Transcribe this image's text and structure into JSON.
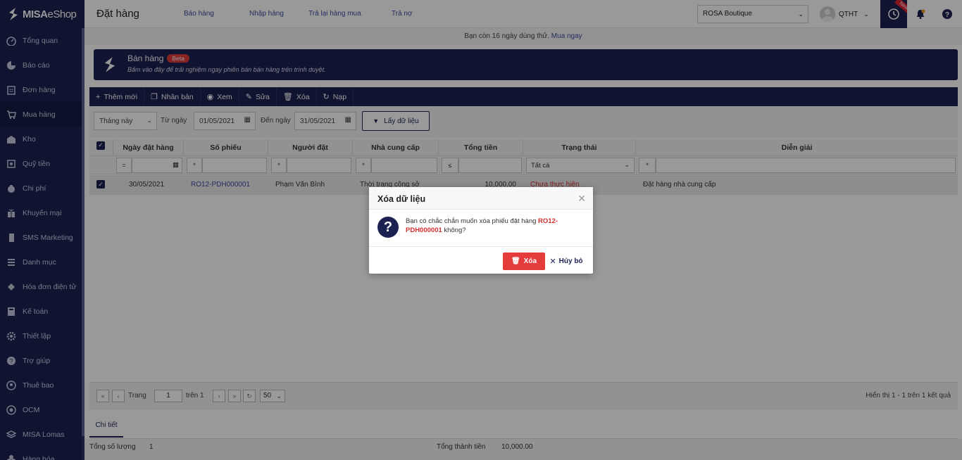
{
  "brand": {
    "name_bold": "MISA",
    "name_light": "eShop"
  },
  "sidebar": {
    "items": [
      {
        "label": "Tổng quan",
        "icon": "dashboard-icon"
      },
      {
        "label": "Báo cáo",
        "icon": "pie-chart-icon"
      },
      {
        "label": "Đơn hàng",
        "icon": "order-icon"
      },
      {
        "label": "Mua hàng",
        "icon": "cart-icon"
      },
      {
        "label": "Kho",
        "icon": "warehouse-icon"
      },
      {
        "label": "Quỹ tiền",
        "icon": "safe-icon"
      },
      {
        "label": "Chi phí",
        "icon": "money-bag-icon"
      },
      {
        "label": "Khuyến mại",
        "icon": "gift-icon"
      },
      {
        "label": "SMS Marketing",
        "icon": "phone-icon"
      },
      {
        "label": "Danh mục",
        "icon": "list-icon"
      },
      {
        "label": "Hóa đơn điện tử",
        "icon": "invoice-icon"
      },
      {
        "label": "Kế toán",
        "icon": "calculator-icon"
      },
      {
        "label": "Thiết lập",
        "icon": "gear-icon"
      },
      {
        "label": "Trợ giúp",
        "icon": "help-icon"
      },
      {
        "label": "Thuê bao",
        "icon": "user-icon"
      },
      {
        "label": "OCM",
        "icon": "ocm-icon"
      },
      {
        "label": "MISA Lomas",
        "icon": "lomas-icon"
      },
      {
        "label": "Hàng hóa",
        "icon": "goods-icon"
      }
    ]
  },
  "header": {
    "title": "Đặt hàng",
    "links": [
      "Báo hàng",
      "Nhập hàng",
      "Trả lại hàng mua",
      "Trả nợ"
    ],
    "shop": "ROSA Boutique",
    "user": "QTHT",
    "new_badge": "New"
  },
  "trial": {
    "text": "Bạn còn 16 ngày dùng thử.",
    "link": "Mua ngay"
  },
  "banner": {
    "title": "Bán hàng",
    "badge": "Beta",
    "subtitle": "Bấm vào đây để trải nghiệm ngay phiên bán bán hàng trên trình duyệt."
  },
  "toolbar": {
    "add": "Thêm mới",
    "copy": "Nhân bản",
    "view": "Xem",
    "edit": "Sửa",
    "delete": "Xóa",
    "reload": "Nạp"
  },
  "filters": {
    "period": "Tháng này",
    "from_label": "Từ ngày",
    "from": "01/05/2021",
    "to_label": "Đến ngày",
    "to": "31/05/2021",
    "get_button": "Lấy dữ liệu"
  },
  "grid": {
    "columns": [
      "Ngày đặt hàng",
      "Số phiếu",
      "Người đặt",
      "Nhà cung cấp",
      "Tổng tiền",
      "Trạng thái",
      "Diễn giải"
    ],
    "filter_ops": {
      "date": "=",
      "number": "*",
      "person": "*",
      "supplier": "*",
      "total": "≤",
      "desc": "*"
    },
    "status_filter": "Tất cả",
    "rows": [
      {
        "date": "30/05/2021",
        "number": "RO12-PDH000001",
        "person": "Phạm Văn Bình",
        "supplier": "Thời trang công sở",
        "total": "10,000.00",
        "status": "Chưa thực hiện",
        "desc": "Đặt hàng nhà cung cấp"
      }
    ]
  },
  "pager": {
    "page_label": "Trang",
    "page": "1",
    "of_label": "trên 1",
    "page_size": "50",
    "summary": "Hiển thị 1 - 1 trên 1 kết quả"
  },
  "detail": {
    "tab": "Chi tiết"
  },
  "summary": {
    "qty_label": "Tổng số lượng",
    "qty": "1",
    "total_label": "Tổng thành tiền",
    "total": "10,000.00"
  },
  "dialog": {
    "title": "Xóa dữ liệu",
    "message_before": "Bạn có chắc chắn muốn xóa phiếu đặt hàng",
    "doc_number": "RO12-PDH000001",
    "message_after": "không?",
    "delete_button": "Xóa",
    "cancel_button": "Hủy bỏ"
  },
  "colors": {
    "navy": "#1b2252",
    "red": "#e43b3b",
    "link": "#3b4ca0"
  }
}
